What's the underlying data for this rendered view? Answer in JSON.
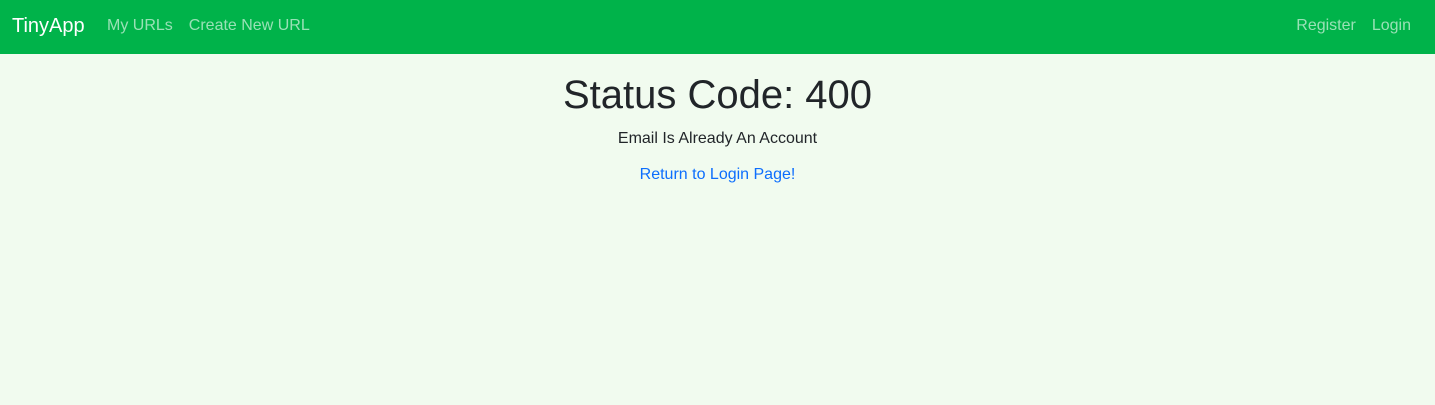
{
  "navbar": {
    "brand": "TinyApp",
    "left_links": [
      "My URLs",
      "Create New URL"
    ],
    "right_links": [
      "Register",
      "Login"
    ],
    "background_color": "#00b34a"
  },
  "main": {
    "title": "Status Code: 400",
    "message": "Email Is Already An Account",
    "link_text": "Return to Login Page!"
  },
  "colors": {
    "page_background": "#f1fbef",
    "link": "#0d6efd"
  }
}
